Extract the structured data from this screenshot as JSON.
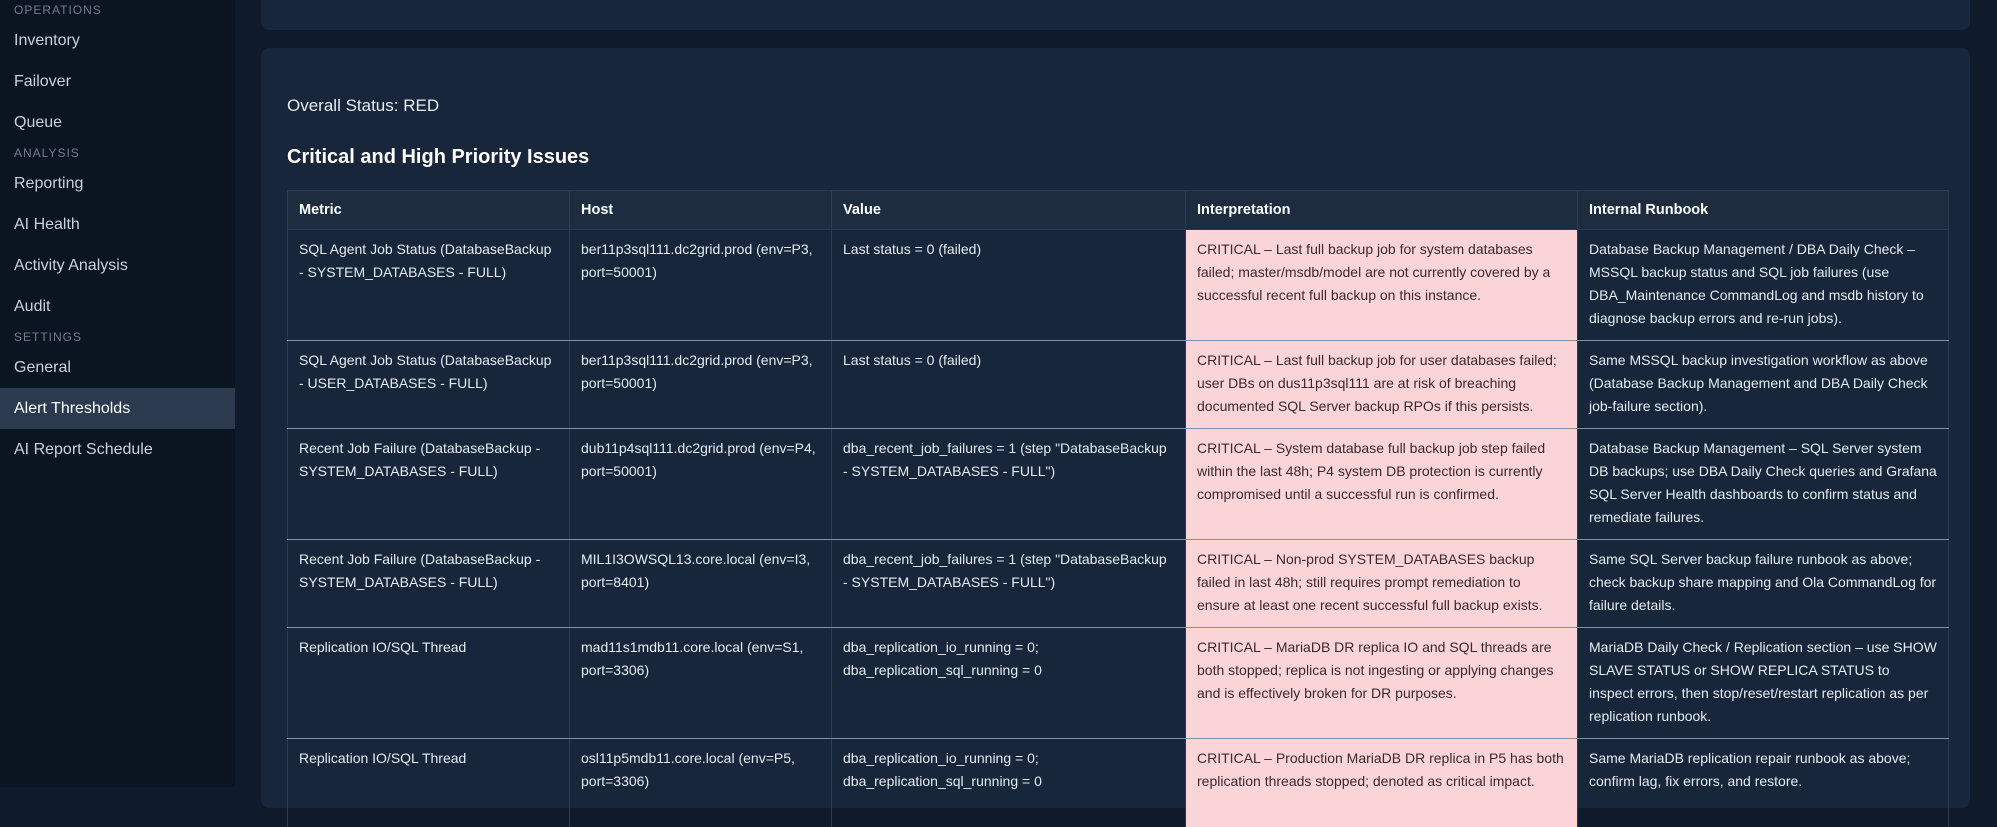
{
  "sidebar": {
    "sections": [
      {
        "title": "OPERATIONS",
        "items": [
          "Inventory",
          "Failover",
          "Queue"
        ]
      },
      {
        "title": "ANALYSIS",
        "items": [
          "Reporting",
          "AI Health",
          "Activity Analysis",
          "Audit"
        ]
      },
      {
        "title": "SETTINGS",
        "items": [
          "General",
          "Alert Thresholds",
          "AI Report Schedule"
        ]
      }
    ],
    "active_item": "Alert Thresholds"
  },
  "report": {
    "overall_status": "Overall Status: RED",
    "heading": "Critical and High Priority Issues",
    "columns": [
      "Metric",
      "Host",
      "Value",
      "Interpretation",
      "Internal Runbook"
    ],
    "rows": [
      {
        "metric": "SQL Agent Job Status (DatabaseBackup - SYSTEM_DATABASES - FULL)",
        "host": "ber11p3sql111.dc2grid.prod (env=P3, port=50001)",
        "value": "Last status = 0 (failed)",
        "interpretation": "CRITICAL – Last full backup job for system databases failed; master/msdb/model are not currently covered by a successful recent full backup on this instance.",
        "runbook": "Database Backup Management / DBA Daily Check – MSSQL backup status and SQL job failures (use DBA_Maintenance CommandLog and msdb history to diagnose backup errors and re-run jobs)."
      },
      {
        "metric": "SQL Agent Job Status (DatabaseBackup - USER_DATABASES - FULL)",
        "host": "ber11p3sql111.dc2grid.prod (env=P3, port=50001)",
        "value": "Last status = 0 (failed)",
        "interpretation": "CRITICAL – Last full backup job for user databases failed; user DBs on dus11p3sql111 are at risk of breaching documented SQL Server backup RPOs if this persists.",
        "runbook": "Same MSSQL backup investigation workflow as above (Database Backup Management and DBA Daily Check job-failure section)."
      },
      {
        "metric": "Recent Job Failure (DatabaseBackup - SYSTEM_DATABASES - FULL)",
        "host": "dub11p4sql111.dc2grid.prod (env=P4, port=50001)",
        "value": "dba_recent_job_failures = 1 (step \"DatabaseBackup - SYSTEM_DATABASES - FULL\")",
        "interpretation": "CRITICAL – System database full backup job step failed within the last 48h; P4 system DB protection is currently compromised until a successful run is confirmed.",
        "runbook": "Database Backup Management – SQL Server system DB backups; use DBA Daily Check queries and Grafana SQL Server Health dashboards to confirm status and remediate failures."
      },
      {
        "metric": "Recent Job Failure (DatabaseBackup - SYSTEM_DATABASES - FULL)",
        "host": "MIL1I3OWSQL13.core.local (env=I3, port=8401)",
        "value": "dba_recent_job_failures = 1 (step \"DatabaseBackup - SYSTEM_DATABASES - FULL\")",
        "interpretation": "CRITICAL – Non-prod SYSTEM_DATABASES backup failed in last 48h; still requires prompt remediation to ensure at least one recent successful full backup exists.",
        "runbook": "Same SQL Server backup failure runbook as above; check backup share mapping and Ola CommandLog for failure details."
      },
      {
        "metric": "Replication IO/SQL Thread",
        "host": "mad11s1mdb11.core.local (env=S1, port=3306)",
        "value": "dba_replication_io_running = 0; dba_replication_sql_running = 0",
        "interpretation": "CRITICAL – MariaDB DR replica IO and SQL threads are both stopped; replica is not ingesting or applying changes and is effectively broken for DR purposes.",
        "runbook": "MariaDB Daily Check / Replication section – use SHOW SLAVE STATUS or SHOW REPLICA STATUS to inspect errors, then stop/reset/restart replication as per replication runbook."
      },
      {
        "metric": "Replication IO/SQL Thread",
        "host": "osl11p5mdb11.core.local (env=P5, port=3306)",
        "value": "dba_replication_io_running = 0; dba_replication_sql_running = 0",
        "interpretation": "CRITICAL – Production MariaDB DR replica in P5 has both replication threads stopped; denoted as critical impact.",
        "runbook": "Same MariaDB replication repair runbook as above; confirm lag, fix errors, and restore."
      }
    ]
  },
  "colors": {
    "sidebar_bg": "#0b1421",
    "page_bg": "#0f1a2a",
    "card_bg": "#17263a",
    "active_item_bg": "#2b3a4e",
    "critical_cell_bg": "#fbd4d8"
  }
}
